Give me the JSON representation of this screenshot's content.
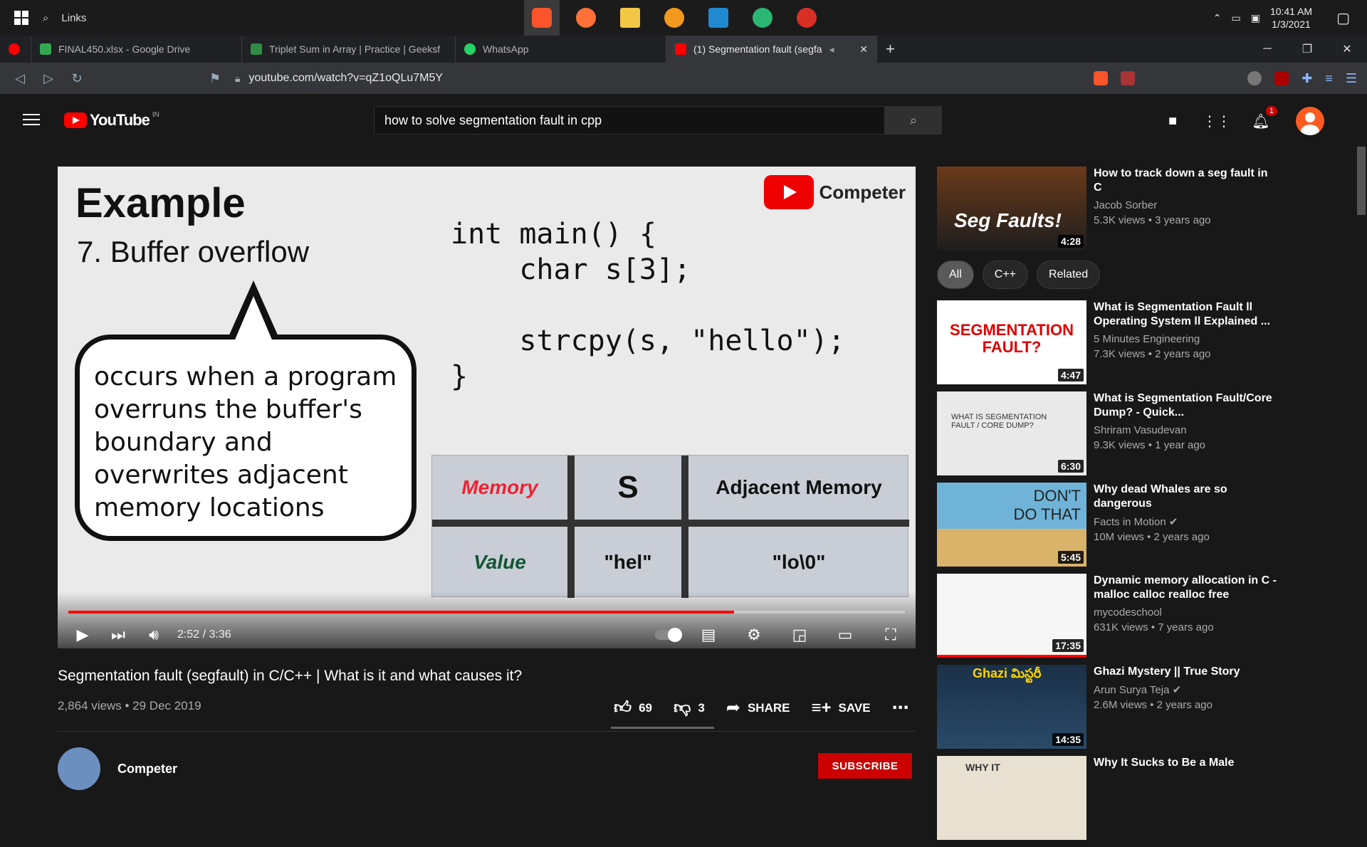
{
  "taskbar": {
    "search_label": "Links",
    "clock_time": "10:41 AM",
    "clock_date": "1/3/2021"
  },
  "tabs": [
    {
      "label": "FINAL450.xlsx - Google Drive",
      "color": "#34a853"
    },
    {
      "label": "Triplet Sum in Array | Practice | Geeksf",
      "color": "#2f8d46"
    },
    {
      "label": "WhatsApp",
      "color": "#25d366"
    },
    {
      "label": "(1) Segmentation fault (segfa",
      "color": "#ff0000",
      "active": true
    }
  ],
  "address": {
    "url": "youtube.com/watch?v=qZ1oQLu7M5Y"
  },
  "youtube": {
    "logo_text": "YouTube",
    "country": "IN",
    "search_query": "how to solve segmentation fault in cpp",
    "notif_count": "1"
  },
  "slide": {
    "title": "Example",
    "subtitle": "7. Buffer overflow",
    "bubble_text": "occurs when a program overruns the buffer's boundary and overwrites adjacent memory locations",
    "code": "int main() {\n    char s[3];\n\n    strcpy(s, \"hello\");\n}",
    "table": {
      "h1": "Memory",
      "h2": "S",
      "h3": "Adjacent Memory",
      "r1": "Value",
      "r2": "\"hel\"",
      "r3": "\"lo\\0\""
    },
    "brand": "Competer"
  },
  "player": {
    "time": "2:52 / 3:36",
    "progress_pct": 79.6
  },
  "video": {
    "title": "Segmentation fault (segfault) in C/C++ | What is it and what causes it?",
    "meta": "2,864 views • 29 Dec 2019",
    "likes": "69",
    "dislikes": "3",
    "share": "SHARE",
    "save": "SAVE",
    "channel": "Competer",
    "subscribe": "SUBSCRIBE"
  },
  "sidebar": {
    "chips": [
      "All",
      "C++",
      "Related"
    ],
    "recs": [
      {
        "title": "How to track down a seg fault in C",
        "channel": "Jacob Sorber",
        "views": "5.3K views • 3 years ago",
        "duration": "4:28",
        "thumb_text": "Seg Faults!",
        "thumb_bg": "#3a2418"
      },
      {
        "title": "What is Segmentation Fault ll Operating System ll Explained ...",
        "channel": "5 Minutes Engineering",
        "views": "7.3K views • 2 years ago",
        "duration": "4:47",
        "thumb_text": "SEGMENTATION FAULT?",
        "thumb_bg": "#ffffff"
      },
      {
        "title": "What is Segmentation Fault/Core Dump? - Quick...",
        "channel": "Shriram Vasudevan",
        "views": "9.3K views • 1 year ago",
        "duration": "6:30",
        "thumb_text": "WHAT IS SEGMENTATION FAULT / CORE DUMP?",
        "thumb_bg": "#e9e9e9"
      },
      {
        "title": "Why dead Whales are so dangerous",
        "channel": "Facts in Motion",
        "views": "10M views • 2 years ago",
        "duration": "5:45",
        "thumb_text": "DON'T DO THAT",
        "thumb_bg": "#6fb4d8"
      },
      {
        "title": "Dynamic memory allocation in C - malloc calloc realloc free",
        "channel": "mycodeschool",
        "views": "631K views • 7 years ago",
        "duration": "17:35",
        "thumb_text": "",
        "thumb_bg": "#f6f6f6"
      },
      {
        "title": "Ghazi Mystery || True Story",
        "channel": "Arun Surya Teja",
        "views": "2.6M views • 2 years ago",
        "duration": "14:35",
        "thumb_text": "Ghazi మిస్టరీ",
        "thumb_bg": "#1a3048"
      },
      {
        "title": "Why It Sucks to Be a Male",
        "channel": "",
        "views": "",
        "duration": "",
        "thumb_text": "WHY IT",
        "thumb_bg": "#e8e0d0"
      }
    ]
  }
}
